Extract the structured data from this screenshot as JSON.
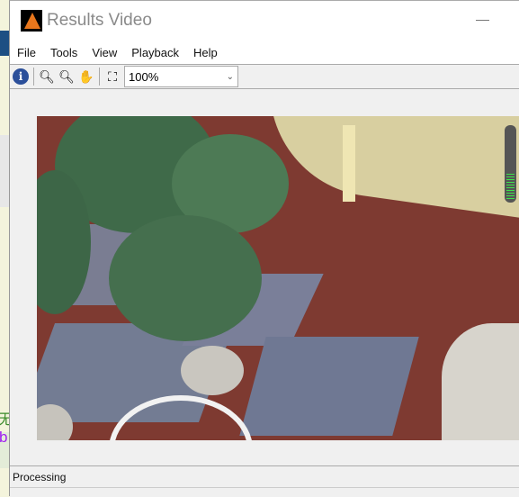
{
  "background": {
    "text1": "无",
    "text2": "b"
  },
  "window": {
    "title": "Results Video",
    "icon": "matlab-logo"
  },
  "menu": [
    "File",
    "Tools",
    "View",
    "Playback",
    "Help"
  ],
  "toolbar": {
    "icons": [
      "info-icon",
      "zoom-in-icon",
      "zoom-out-icon",
      "pan-hand-icon",
      "fit-to-window-icon"
    ],
    "zoom_value": "100%"
  },
  "video": {
    "description_icon": "video-frame",
    "meter_level": 0.35
  },
  "status": {
    "text": "Processing"
  }
}
